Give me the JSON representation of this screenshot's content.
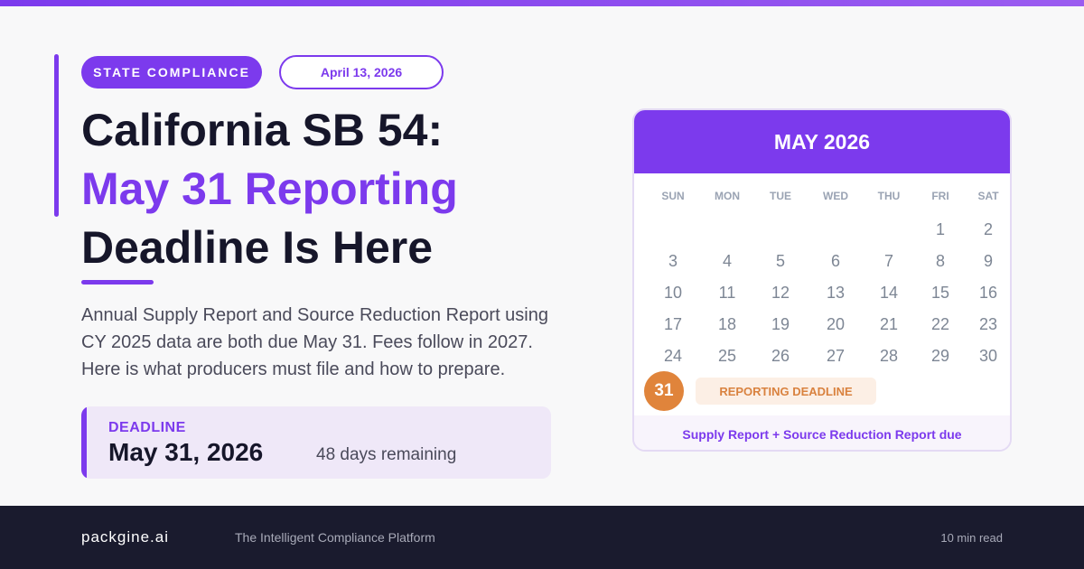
{
  "colors": {
    "accent": "#7c3aed",
    "highlight": "#e0843b",
    "footer_bg": "#1a1b2e"
  },
  "header": {
    "category": "STATE COMPLIANCE",
    "date": "April 13, 2026"
  },
  "headline": {
    "line1": "California SB 54:",
    "line2": "May 31 Reporting",
    "line3": "Deadline Is Here"
  },
  "description": "Annual Supply Report and Source Reduction Report using CY 2025 data are both due May 31. Fees follow in 2027. Here is what producers must file and how to prepare.",
  "deadline": {
    "label": "DEADLINE",
    "date": "May 31, 2026",
    "remaining": "48 days remaining"
  },
  "calendar": {
    "month": "MAY 2026",
    "weekdays": [
      "SUN",
      "MON",
      "TUE",
      "WED",
      "THU",
      "FRI",
      "SAT"
    ],
    "first_weekday_index": 5,
    "days_in_month": 31,
    "highlight_day": "31",
    "highlight_label": "REPORTING DEADLINE",
    "footer": "Supply Report + Source Reduction Report due"
  },
  "footer": {
    "brand": "packgine.ai",
    "tagline": "The Intelligent Compliance Platform",
    "read_time": "10 min read"
  }
}
